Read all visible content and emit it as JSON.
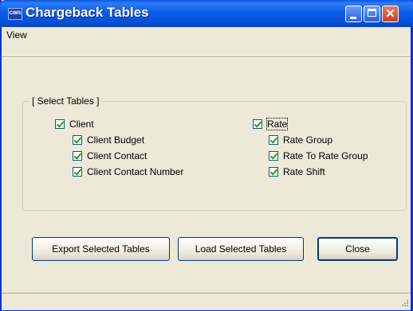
{
  "window": {
    "title": "Chargeback Tables",
    "app_icon_text": "CIMS"
  },
  "menu": {
    "items": [
      "View"
    ]
  },
  "group": {
    "legend": "[ Select Tables ]",
    "client": {
      "label": "Client",
      "checked": true,
      "children": [
        {
          "label": "Client Budget",
          "checked": true
        },
        {
          "label": "Client Contact",
          "checked": true
        },
        {
          "label": "Client Contact Number",
          "checked": true
        }
      ]
    },
    "rate": {
      "label": "Rate",
      "checked": true,
      "children": [
        {
          "label": "Rate Group",
          "checked": true
        },
        {
          "label": "Rate To Rate Group",
          "checked": true
        },
        {
          "label": "Rate Shift",
          "checked": true
        }
      ]
    }
  },
  "buttons": {
    "export": "Export Selected Tables",
    "load": "Load Selected Tables",
    "close": "Close"
  }
}
